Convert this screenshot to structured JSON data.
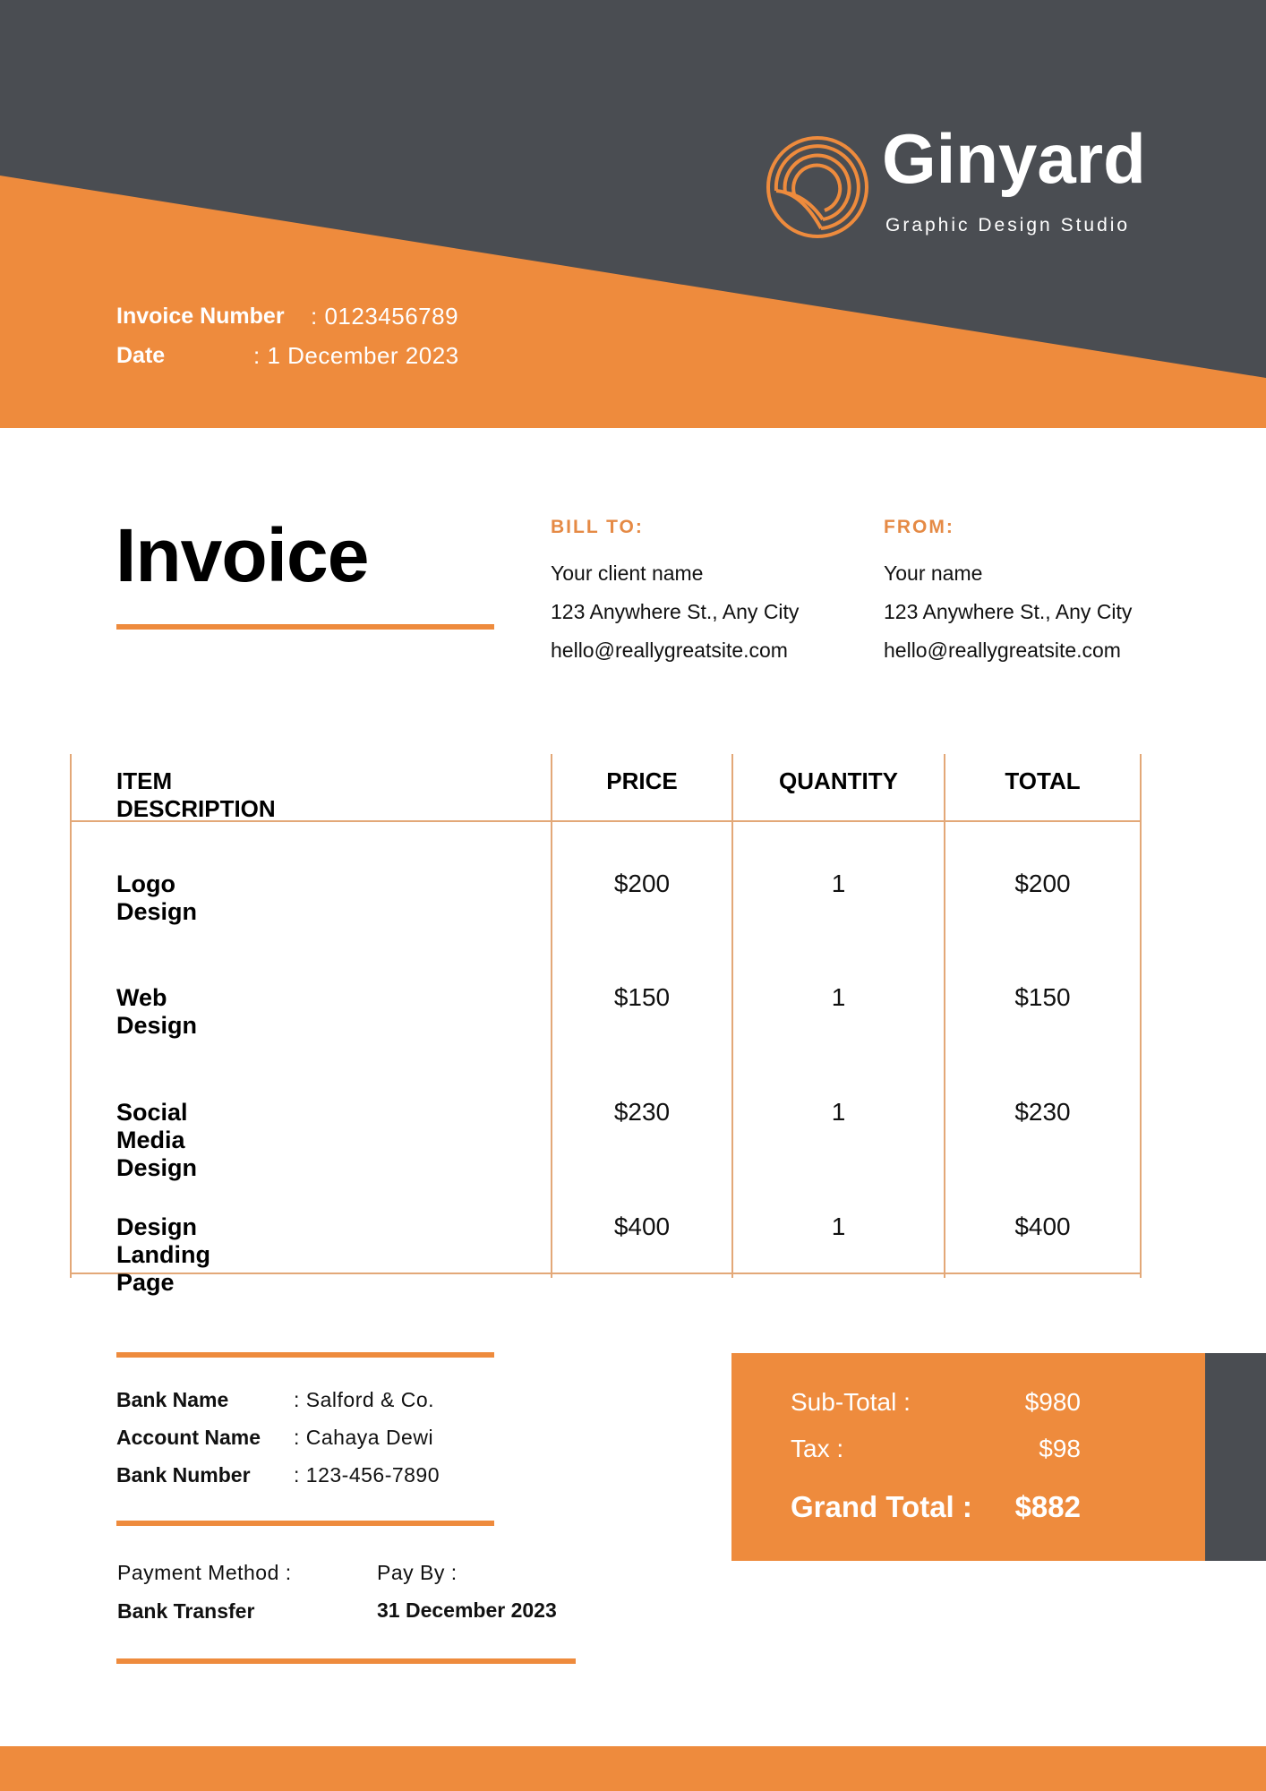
{
  "colors": {
    "accent": "#ee8b3d",
    "dark": "#4a4d52",
    "rule": "#e3a878"
  },
  "brand": {
    "name": "Ginyard",
    "tagline": "Graphic Design Studio",
    "logo_icon": "concentric-arcs-icon"
  },
  "meta": {
    "invoice_number_label": "Invoice Number",
    "invoice_number_value": ": 0123456789",
    "date_label": "Date",
    "date_value": ": 1 December 2023"
  },
  "title": "Invoice",
  "bill_to": {
    "heading": "BILL TO:",
    "name": "Your client name",
    "address": "123 Anywhere St., Any City",
    "email": "hello@reallygreatsite.com"
  },
  "from": {
    "heading": "FROM:",
    "name": "Your name",
    "address": "123 Anywhere St., Any City",
    "email": "hello@reallygreatsite.com"
  },
  "table": {
    "headers": [
      "ITEM DESCRIPTION",
      "PRICE",
      "QUANTITY",
      "TOTAL"
    ],
    "rows": [
      {
        "description": "Logo Design",
        "price": "$200",
        "quantity": "1",
        "total": "$200"
      },
      {
        "description": "Web Design",
        "price": "$150",
        "quantity": "1",
        "total": "$150"
      },
      {
        "description": "Social Media Design",
        "price": "$230",
        "quantity": "1",
        "total": "$230"
      },
      {
        "description": "Design Landing Page",
        "price": "$400",
        "quantity": "1",
        "total": "$400"
      }
    ]
  },
  "bank": {
    "bank_name_label": "Bank Name",
    "bank_name_value": ": Salford & Co.",
    "account_name_label": "Account Name",
    "account_name_value": ": Cahaya Dewi",
    "bank_number_label": "Bank Number",
    "bank_number_value": ": 123-456-7890"
  },
  "payment": {
    "method_label": "Payment Method :",
    "method_value": "Bank Transfer",
    "pay_by_label": "Pay By :",
    "pay_by_value": "31 December 2023"
  },
  "totals": {
    "subtotal_label": "Sub-Total :",
    "subtotal_value": "$980",
    "tax_label": "Tax  :",
    "tax_value": "$98",
    "grand_label": "Grand Total :",
    "grand_value": "$882"
  }
}
